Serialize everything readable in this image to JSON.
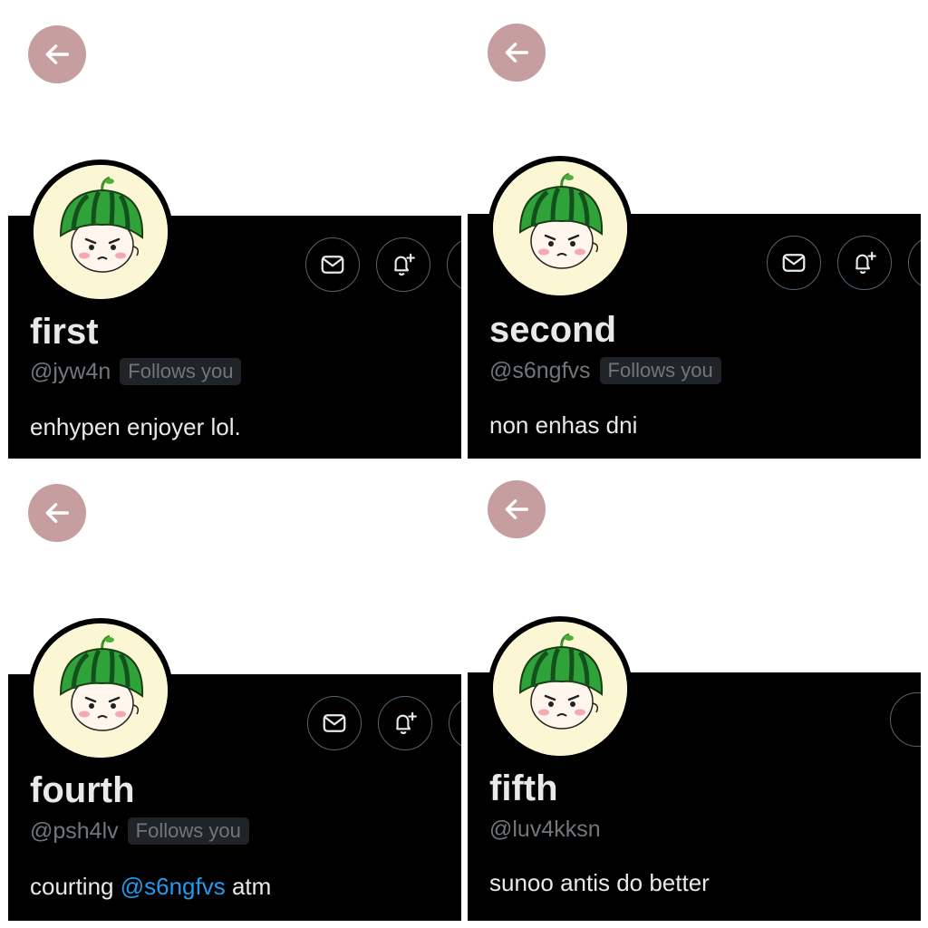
{
  "colors": {
    "back_button": "#c79e9f",
    "background": "#000000",
    "mention": "#1d9bf0",
    "avatar_bg": "#fbf6d3"
  },
  "profiles": [
    {
      "name": "first",
      "handle": "@jyw4n",
      "follows_you": "Follows you",
      "bio_pre": "enhypen enjoyer lol.",
      "bio_mention": "",
      "bio_post": ""
    },
    {
      "name": "second",
      "handle": "@s6ngfvs",
      "follows_you": "Follows you",
      "bio_pre": "non enhas dni",
      "bio_mention": "",
      "bio_post": ""
    },
    {
      "name": "fourth",
      "handle": "@psh4lv",
      "follows_you": "Follows you",
      "bio_pre": "courting ",
      "bio_mention": "@s6ngfvs",
      "bio_post": " atm"
    },
    {
      "name": "fifth",
      "handle": "@luv4kksn",
      "follows_you": "",
      "bio_pre": "sunoo antis do better",
      "bio_mention": "",
      "bio_post": ""
    }
  ]
}
